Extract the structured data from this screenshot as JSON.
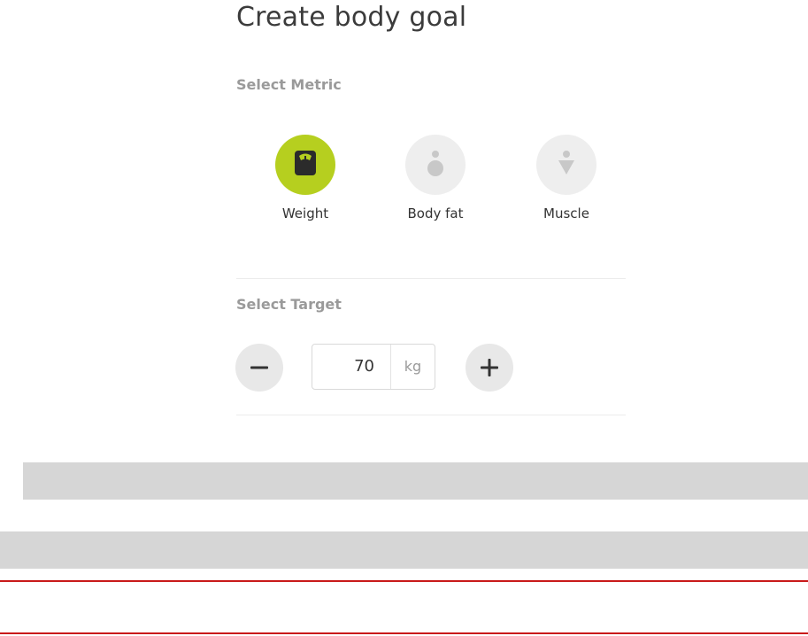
{
  "page": {
    "title": "Create body goal"
  },
  "metric_section": {
    "label": "Select Metric",
    "selected": "Weight",
    "options": [
      {
        "label": "Weight",
        "icon": "scale-icon",
        "selected": true
      },
      {
        "label": "Body fat",
        "icon": "body-fat-icon",
        "selected": false
      },
      {
        "label": "Muscle",
        "icon": "muscle-icon",
        "selected": false
      }
    ]
  },
  "target_section": {
    "label": "Select Target",
    "value": "70",
    "unit": "kg",
    "decrement_icon": "minus-icon",
    "increment_icon": "plus-icon"
  },
  "colors": {
    "accent": "#b6cf1f",
    "icon_inactive": "#c8c8c8",
    "icon_dark": "#2b2b2b",
    "placeholder_bar": "#d6d6d6",
    "red_rule": "#c91a1a"
  }
}
